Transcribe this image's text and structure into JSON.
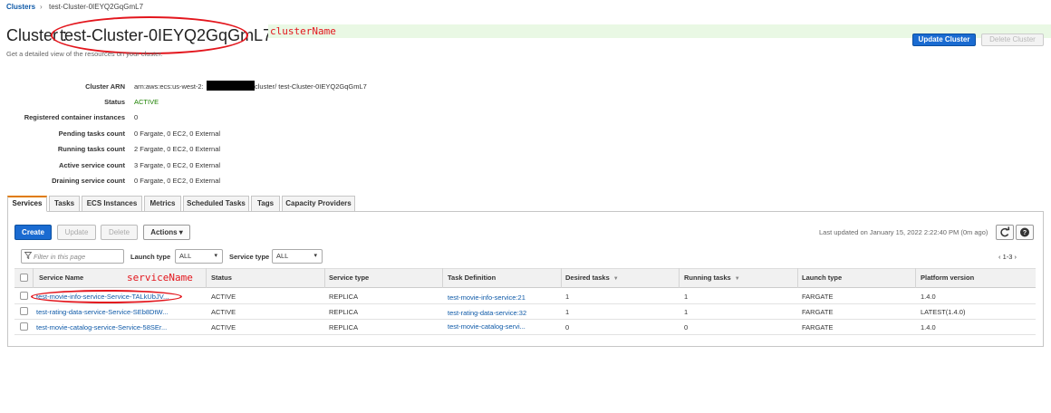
{
  "breadcrumb": {
    "root": "Clusters",
    "separator": "›",
    "current": "test-Cluster-0IEYQ2GqGmL7"
  },
  "header": {
    "title_prefix": "Cluster : ",
    "cluster_name": "test-Cluster-0IEYQ2GqGmL7",
    "annotation": "clusterName",
    "subtitle": "Get a detailed view of the resources on your cluster.",
    "update_button": "Update Cluster",
    "delete_button": "Delete Cluster"
  },
  "details": [
    {
      "label": "Cluster ARN",
      "value_prefix": "arn:aws:ecs:us-west-2:",
      "value_suffix": "cluster/ test-Cluster-0IEYQ2GqGmL7"
    },
    {
      "label": "Status",
      "value": "ACTIVE"
    },
    {
      "label": "Registered container instances",
      "value": "0"
    },
    {
      "label": "Pending tasks count",
      "value": "0 Fargate, 0 EC2, 0 External"
    },
    {
      "label": "Running tasks count",
      "value": "2 Fargate, 0 EC2, 0 External"
    },
    {
      "label": "Active service count",
      "value": "3 Fargate, 0 EC2, 0 External"
    },
    {
      "label": "Draining service count",
      "value": "0 Fargate, 0 EC2, 0 External"
    }
  ],
  "tabs": [
    "Services",
    "Tasks",
    "ECS Instances",
    "Metrics",
    "Scheduled Tasks",
    "Tags",
    "Capacity Providers"
  ],
  "toolbar": {
    "create": "Create",
    "update": "Update",
    "delete": "Delete",
    "actions": "Actions ▾",
    "last_updated": "Last updated on January 15, 2022 2:22:40 PM (0m ago)",
    "refresh_icon": "refresh-icon",
    "help_icon": "help-icon"
  },
  "filters": {
    "search_placeholder": "Filter in this page",
    "launch_type_label": "Launch type",
    "launch_type_value": "ALL",
    "service_type_label": "Service type",
    "service_type_value": "ALL",
    "pager": "‹  1-3  ›"
  },
  "table": {
    "annotation": "serviceName",
    "columns": [
      "Service Name",
      "Status",
      "Service type",
      "Task Definition",
      "Desired tasks",
      "Running tasks",
      "Launch type",
      "Platform version"
    ],
    "rows": [
      [
        "test-movie-info-service-Service-TALkUbJV...",
        "ACTIVE",
        "REPLICA",
        "test-movie-info-service:21",
        "1",
        "1",
        "FARGATE",
        "1.4.0"
      ],
      [
        "test-rating-data-service-Service-SEb8DtW...",
        "ACTIVE",
        "REPLICA",
        "test-rating-data-service:32",
        "1",
        "1",
        "FARGATE",
        "LATEST(1.4.0)"
      ],
      [
        "test-movie-catalog-service-Service-58SEr...",
        "ACTIVE",
        "REPLICA",
        "test-movie-catalog-servi...",
        "0",
        "0",
        "FARGATE",
        "1.4.0"
      ]
    ]
  },
  "colors": {
    "accent": "#1a6bd1",
    "status_active": "#1d8102",
    "annotation_red": "#e3161d",
    "tab_active": "#e07b00"
  }
}
